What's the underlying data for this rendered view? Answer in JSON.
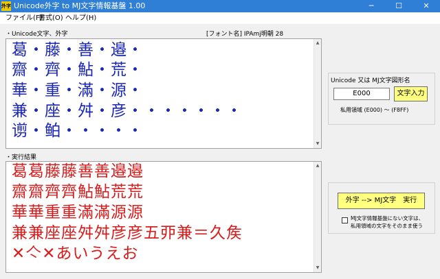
{
  "window": {
    "icon_text": "外字",
    "title": "Unicode外字 to MJ文字情報基盤 1.00",
    "minimize_glyph": "─",
    "maximize_glyph": "☐",
    "close_glyph": "✕"
  },
  "menu": {
    "file": "ファイル(F)",
    "format": "書式(O)",
    "help": "ヘルプ(H)"
  },
  "input_section": {
    "label": "・Unicode文字、外字",
    "font_info": "[フォント名] IPAmj明朝 28",
    "lines": [
      "葛・藤・善・邉・",
      "齋・齊・鮎・荒・",
      "華・重・滿・源・",
      "兼・座・舛・彦・・・・・・・",
      "谫・鲌・・・・・"
    ]
  },
  "result_section": {
    "label": "・実行結果",
    "lines": [
      "葛葛藤藤善善邉邉",
      "齋齋齊齊鮎鮎荒荒",
      "華華重重滿滿源源",
      "兼兼座座舛舛彦彦五丣兼＝久矦",
      "✕亽✕あいうえお"
    ]
  },
  "unicode_group": {
    "title": "Unicode 又は MJ文字図形名",
    "code_value": "E000",
    "char_input_button": "文字入力",
    "range_text": "私用領域 (E000) ～ (F8FF)"
  },
  "convert_group": {
    "execute_button": "外字 --> MJ文字　実行",
    "checkbox_checked": false,
    "checkbox_label_line1": "MJ文字情報基盤にない文字は、",
    "checkbox_label_line2": "私用領域の文字をそのまま使う"
  },
  "colors": {
    "titlebar": "#2f7fd6",
    "input_text": "#1a26b8",
    "result_text": "#d81c1c",
    "button_yellow": "#ffff80"
  }
}
